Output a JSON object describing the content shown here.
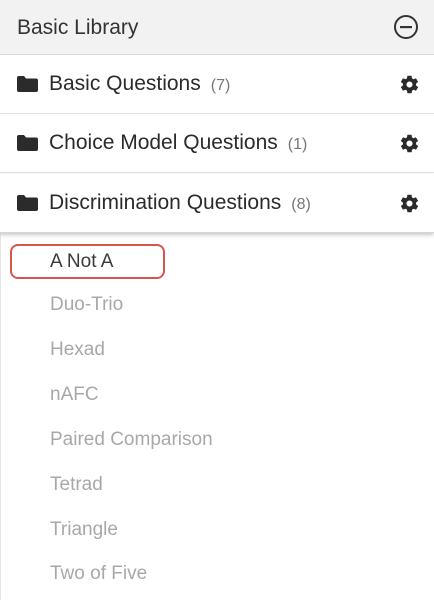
{
  "header": {
    "title": "Basic Library",
    "collapse_icon": "minus-circle-icon"
  },
  "folders": [
    {
      "label": "Basic Questions",
      "count": "(7)",
      "icon": "folder-icon",
      "action_icon": "gear-icon"
    },
    {
      "label": "Choice Model Questions",
      "count": "(1)",
      "icon": "folder-icon",
      "action_icon": "gear-icon"
    },
    {
      "label": "Discrimination Questions",
      "count": "(8)",
      "icon": "folder-icon",
      "action_icon": "gear-icon",
      "expanded": true
    }
  ],
  "questions": [
    {
      "label": "A Not A",
      "selected": true
    },
    {
      "label": "Duo-Trio"
    },
    {
      "label": "Hexad"
    },
    {
      "label": "nAFC"
    },
    {
      "label": "Paired Comparison"
    },
    {
      "label": "Tetrad"
    },
    {
      "label": "Triangle"
    },
    {
      "label": "Two of Five"
    }
  ],
  "colors": {
    "highlight": "#d9534f",
    "header_bg": "#f2f2f2",
    "muted_text": "#a8a8a8"
  }
}
